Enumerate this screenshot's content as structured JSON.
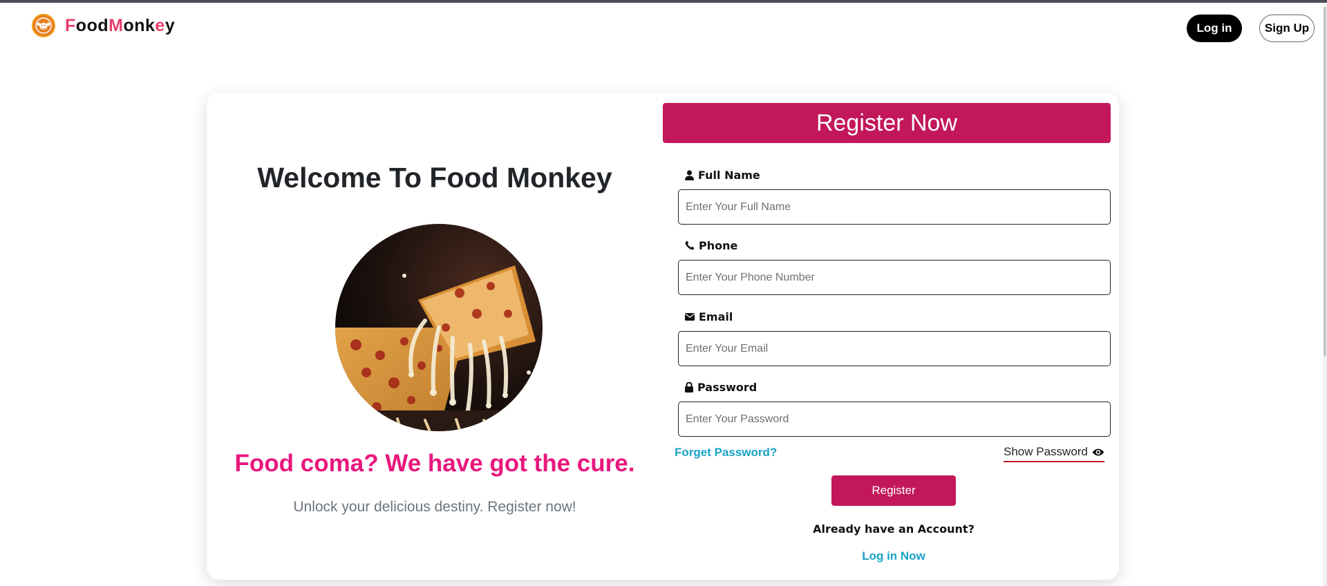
{
  "header": {
    "brand_letters": [
      {
        "ch": "F",
        "color": "#e83e6c"
      },
      {
        "ch": "o",
        "color": "#111111"
      },
      {
        "ch": "o",
        "color": "#111111"
      },
      {
        "ch": "d",
        "color": "#111111"
      },
      {
        "ch": "M",
        "color": "#e83e6c"
      },
      {
        "ch": "o",
        "color": "#111111"
      },
      {
        "ch": "n",
        "color": "#111111"
      },
      {
        "ch": "k",
        "color": "#111111"
      },
      {
        "ch": "e",
        "color": "#e83e6c"
      },
      {
        "ch": "y",
        "color": "#111111"
      }
    ],
    "brand_colors": {
      "accent": "#e83e6c",
      "logo": "#e67e22"
    },
    "logo_icon": "monkey-logo-icon",
    "login_label": "Log in",
    "signup_label": "Sign Up"
  },
  "welcome": {
    "title": "Welcome To Food Monkey",
    "image_icon": "pizza-photo",
    "tagline": "Food coma? We have got the cure.",
    "subtitle": "Unlock your delicious destiny. Register now!"
  },
  "form": {
    "heading": "Register Now",
    "fields": [
      {
        "label": "Full Name",
        "icon": "user-icon",
        "placeholder": "Enter Your Full Name",
        "value": ""
      },
      {
        "label": "Phone",
        "icon": "phone-icon",
        "placeholder": "Enter Your Phone Number",
        "value": ""
      },
      {
        "label": "Email",
        "icon": "envelope-icon",
        "placeholder": "Enter Your Email",
        "value": ""
      },
      {
        "label": "Password",
        "icon": "lock-icon",
        "placeholder": "Enter Your Password",
        "value": ""
      }
    ],
    "forgot_label": "Forget Password?",
    "show_password_label": "Show Password",
    "show_password_icon": "eye-icon",
    "submit_label": "Register",
    "already_text": "Already have an Account?",
    "login_link": "Log in Now"
  },
  "colors": {
    "primary": "#c2185b",
    "tagline": "#e9177c",
    "link": "#17a2c8"
  }
}
